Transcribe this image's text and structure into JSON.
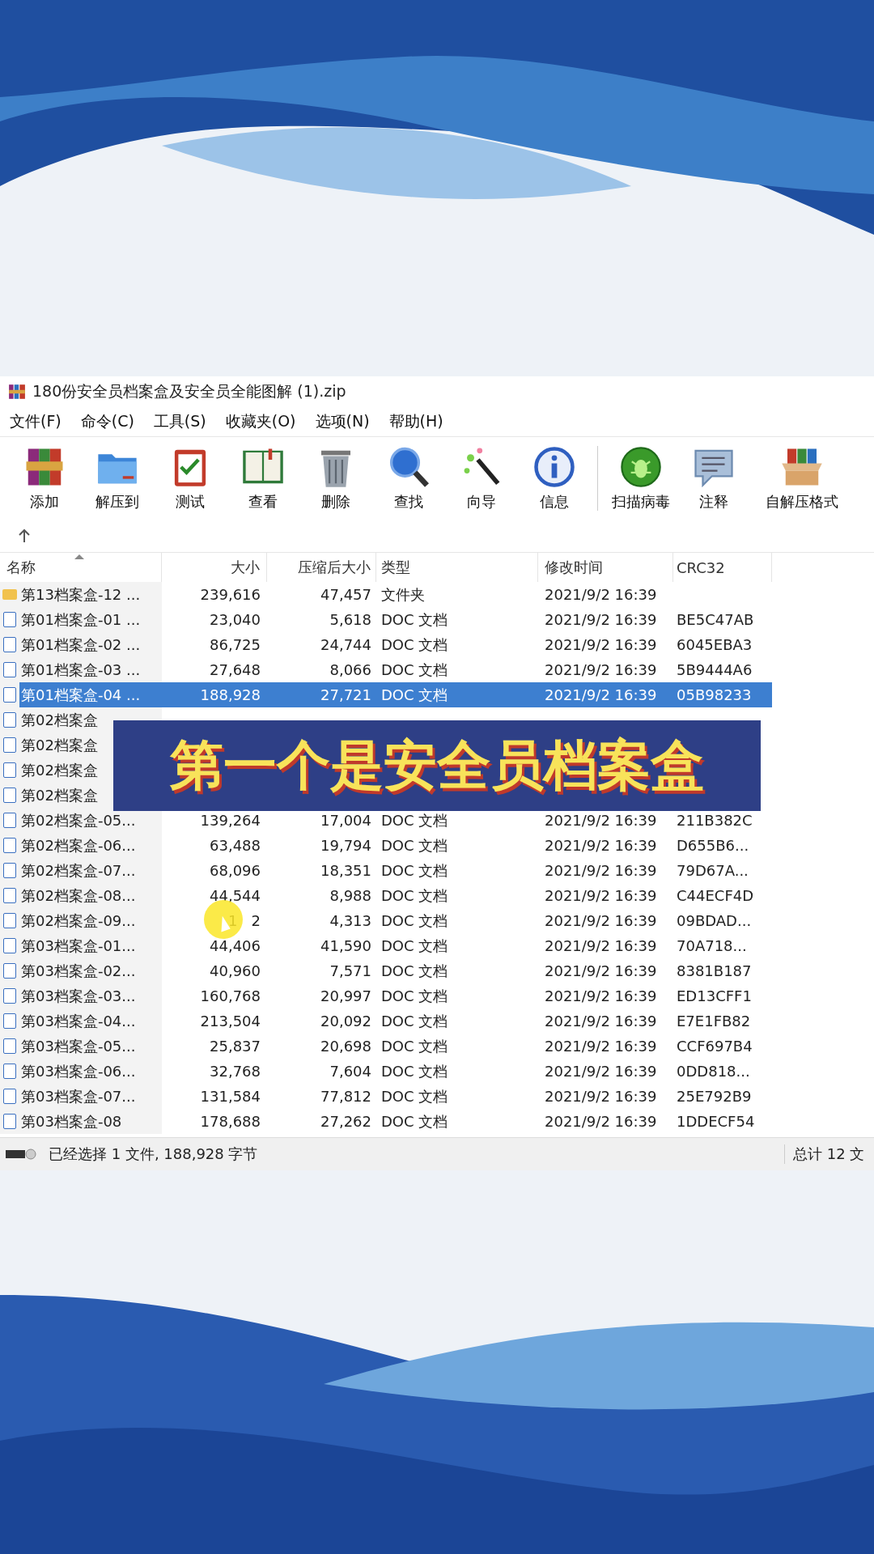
{
  "window": {
    "title": "180份安全员档案盒及安全员全能图解 (1).zip"
  },
  "menu": [
    "文件(F)",
    "命令(C)",
    "工具(S)",
    "收藏夹(O)",
    "选项(N)",
    "帮助(H)"
  ],
  "toolbar": {
    "groups": [
      [
        {
          "label": "添加",
          "kind": "archive"
        },
        {
          "label": "解压到",
          "kind": "folder"
        },
        {
          "label": "测试",
          "kind": "clipboard"
        },
        {
          "label": "查看",
          "kind": "book"
        },
        {
          "label": "删除",
          "kind": "trash"
        },
        {
          "label": "查找",
          "kind": "magnifier"
        },
        {
          "label": "向导",
          "kind": "wand"
        },
        {
          "label": "信息",
          "kind": "info"
        }
      ],
      [
        {
          "label": "扫描病毒",
          "kind": "bug"
        },
        {
          "label": "注释",
          "kind": "note"
        },
        {
          "label": "自解压格式",
          "kind": "box"
        }
      ]
    ]
  },
  "table": {
    "columns": [
      {
        "label": "名称",
        "sorted": true
      },
      {
        "label": "大小",
        "sorted": false
      },
      {
        "label": "压缩后大小",
        "sorted": false
      },
      {
        "label": "类型",
        "sorted": false
      },
      {
        "label": "修改时间",
        "sorted": false
      },
      {
        "label": "CRC32",
        "sorted": false
      }
    ],
    "rows": [
      {
        "kind": "folder",
        "name": "第13档案盒-12 ...",
        "size": "239,616",
        "packed": "47,457",
        "type": "文件夹",
        "modified": "2021/9/2 16:39",
        "selected": false
      },
      {
        "kind": "doc",
        "name": "第01档案盒-01 ...",
        "size": "23,040",
        "packed": "5,618",
        "type": "DOC 文档",
        "modified": "2021/9/2 16:39",
        "crc": "BE5C47AB",
        "selected": false
      },
      {
        "kind": "doc",
        "name": "第01档案盒-02 ...",
        "size": "86,725",
        "packed": "24,744",
        "type": "DOC 文档",
        "modified": "2021/9/2 16:39",
        "crc": "6045EBA3",
        "selected": false
      },
      {
        "kind": "doc",
        "name": "第01档案盒-03 ...",
        "size": "27,648",
        "packed": "8,066",
        "type": "DOC 文档",
        "modified": "2021/9/2 16:39",
        "crc": "5B9444A6",
        "selected": false
      },
      {
        "kind": "doc",
        "name": "第01档案盒-04 ...",
        "size": "188,928",
        "packed": "27,721",
        "type": "DOC 文档",
        "modified": "2021/9/2 16:39",
        "crc": "05B98233",
        "selected": true
      },
      {
        "kind": "doc",
        "name": "第02档案盒",
        "selected": false
      },
      {
        "kind": "doc",
        "name": "第02档案盒",
        "selected": false
      },
      {
        "kind": "doc",
        "name": "第02档案盒",
        "selected": false
      },
      {
        "kind": "doc",
        "name": "第02档案盒",
        "selected": false
      },
      {
        "kind": "doc",
        "name": "第02档案盒-05...",
        "size": "139,264",
        "packed": "17,004",
        "type": "DOC 文档",
        "modified": "2021/9/2 16:39",
        "crc": "211B382C",
        "selected": false
      },
      {
        "kind": "doc",
        "name": "第02档案盒-06...",
        "size": "63,488",
        "packed": "19,794",
        "type": "DOC 文档",
        "modified": "2021/9/2 16:39",
        "crc": "D655B6...",
        "selected": false
      },
      {
        "kind": "doc",
        "name": "第02档案盒-07...",
        "size": "68,096",
        "packed": "18,351",
        "type": "DOC 文档",
        "modified": "2021/9/2 16:39",
        "crc": "79D67A...",
        "selected": false
      },
      {
        "kind": "doc",
        "name": "第02档案盒-08...",
        "size": "44,544",
        "packed": "8,988",
        "type": "DOC 文档",
        "modified": "2021/9/2 16:39",
        "crc": "C44ECF4D",
        "selected": false
      },
      {
        "kind": "doc",
        "name": "第02档案盒-09...",
        "size": "1   2",
        "packed": "4,313",
        "type": "DOC 文档",
        "modified": "2021/9/2 16:39",
        "crc": "09BDAD...",
        "selected": false
      },
      {
        "kind": "doc",
        "name": "第03档案盒-01...",
        "size": "44,406",
        "packed": "41,590",
        "type": "DOC 文档",
        "modified": "2021/9/2 16:39",
        "crc": "70A718...",
        "selected": false
      },
      {
        "kind": "doc",
        "name": "第03档案盒-02...",
        "size": "40,960",
        "packed": "7,571",
        "type": "DOC 文档",
        "modified": "2021/9/2 16:39",
        "crc": "8381B187",
        "selected": false
      },
      {
        "kind": "doc",
        "name": "第03档案盒-03...",
        "size": "160,768",
        "packed": "20,997",
        "type": "DOC 文档",
        "modified": "2021/9/2 16:39",
        "crc": "ED13CFF1",
        "selected": false
      },
      {
        "kind": "doc",
        "name": "第03档案盒-04...",
        "size": "213,504",
        "packed": "20,092",
        "type": "DOC 文档",
        "modified": "2021/9/2 16:39",
        "crc": "E7E1FB82",
        "selected": false
      },
      {
        "kind": "doc",
        "name": "第03档案盒-05...",
        "size": "25,837",
        "packed": "20,698",
        "type": "DOC 文档",
        "modified": "2021/9/2 16:39",
        "crc": "CCF697B4",
        "selected": false
      },
      {
        "kind": "doc",
        "name": "第03档案盒-06...",
        "size": "32,768",
        "packed": "7,604",
        "type": "DOC 文档",
        "modified": "2021/9/2 16:39",
        "crc": "0DD818...",
        "selected": false
      },
      {
        "kind": "doc",
        "name": "第03档案盒-07...",
        "size": "131,584",
        "packed": "77,812",
        "type": "DOC 文档",
        "modified": "2021/9/2 16:39",
        "crc": "25E792B9",
        "selected": false
      },
      {
        "kind": "doc",
        "name": "第03档案盒-08",
        "size": "178,688",
        "packed": "27,262",
        "type": "DOC 文档",
        "modified": "2021/9/2 16:39",
        "crc": "1DDECF54",
        "selected": false
      }
    ]
  },
  "caption": "第一个是安全员档案盒",
  "status_bar": {
    "selection": "已经选择 1 文件, 188,928 字节",
    "total": "总计 12 文"
  }
}
